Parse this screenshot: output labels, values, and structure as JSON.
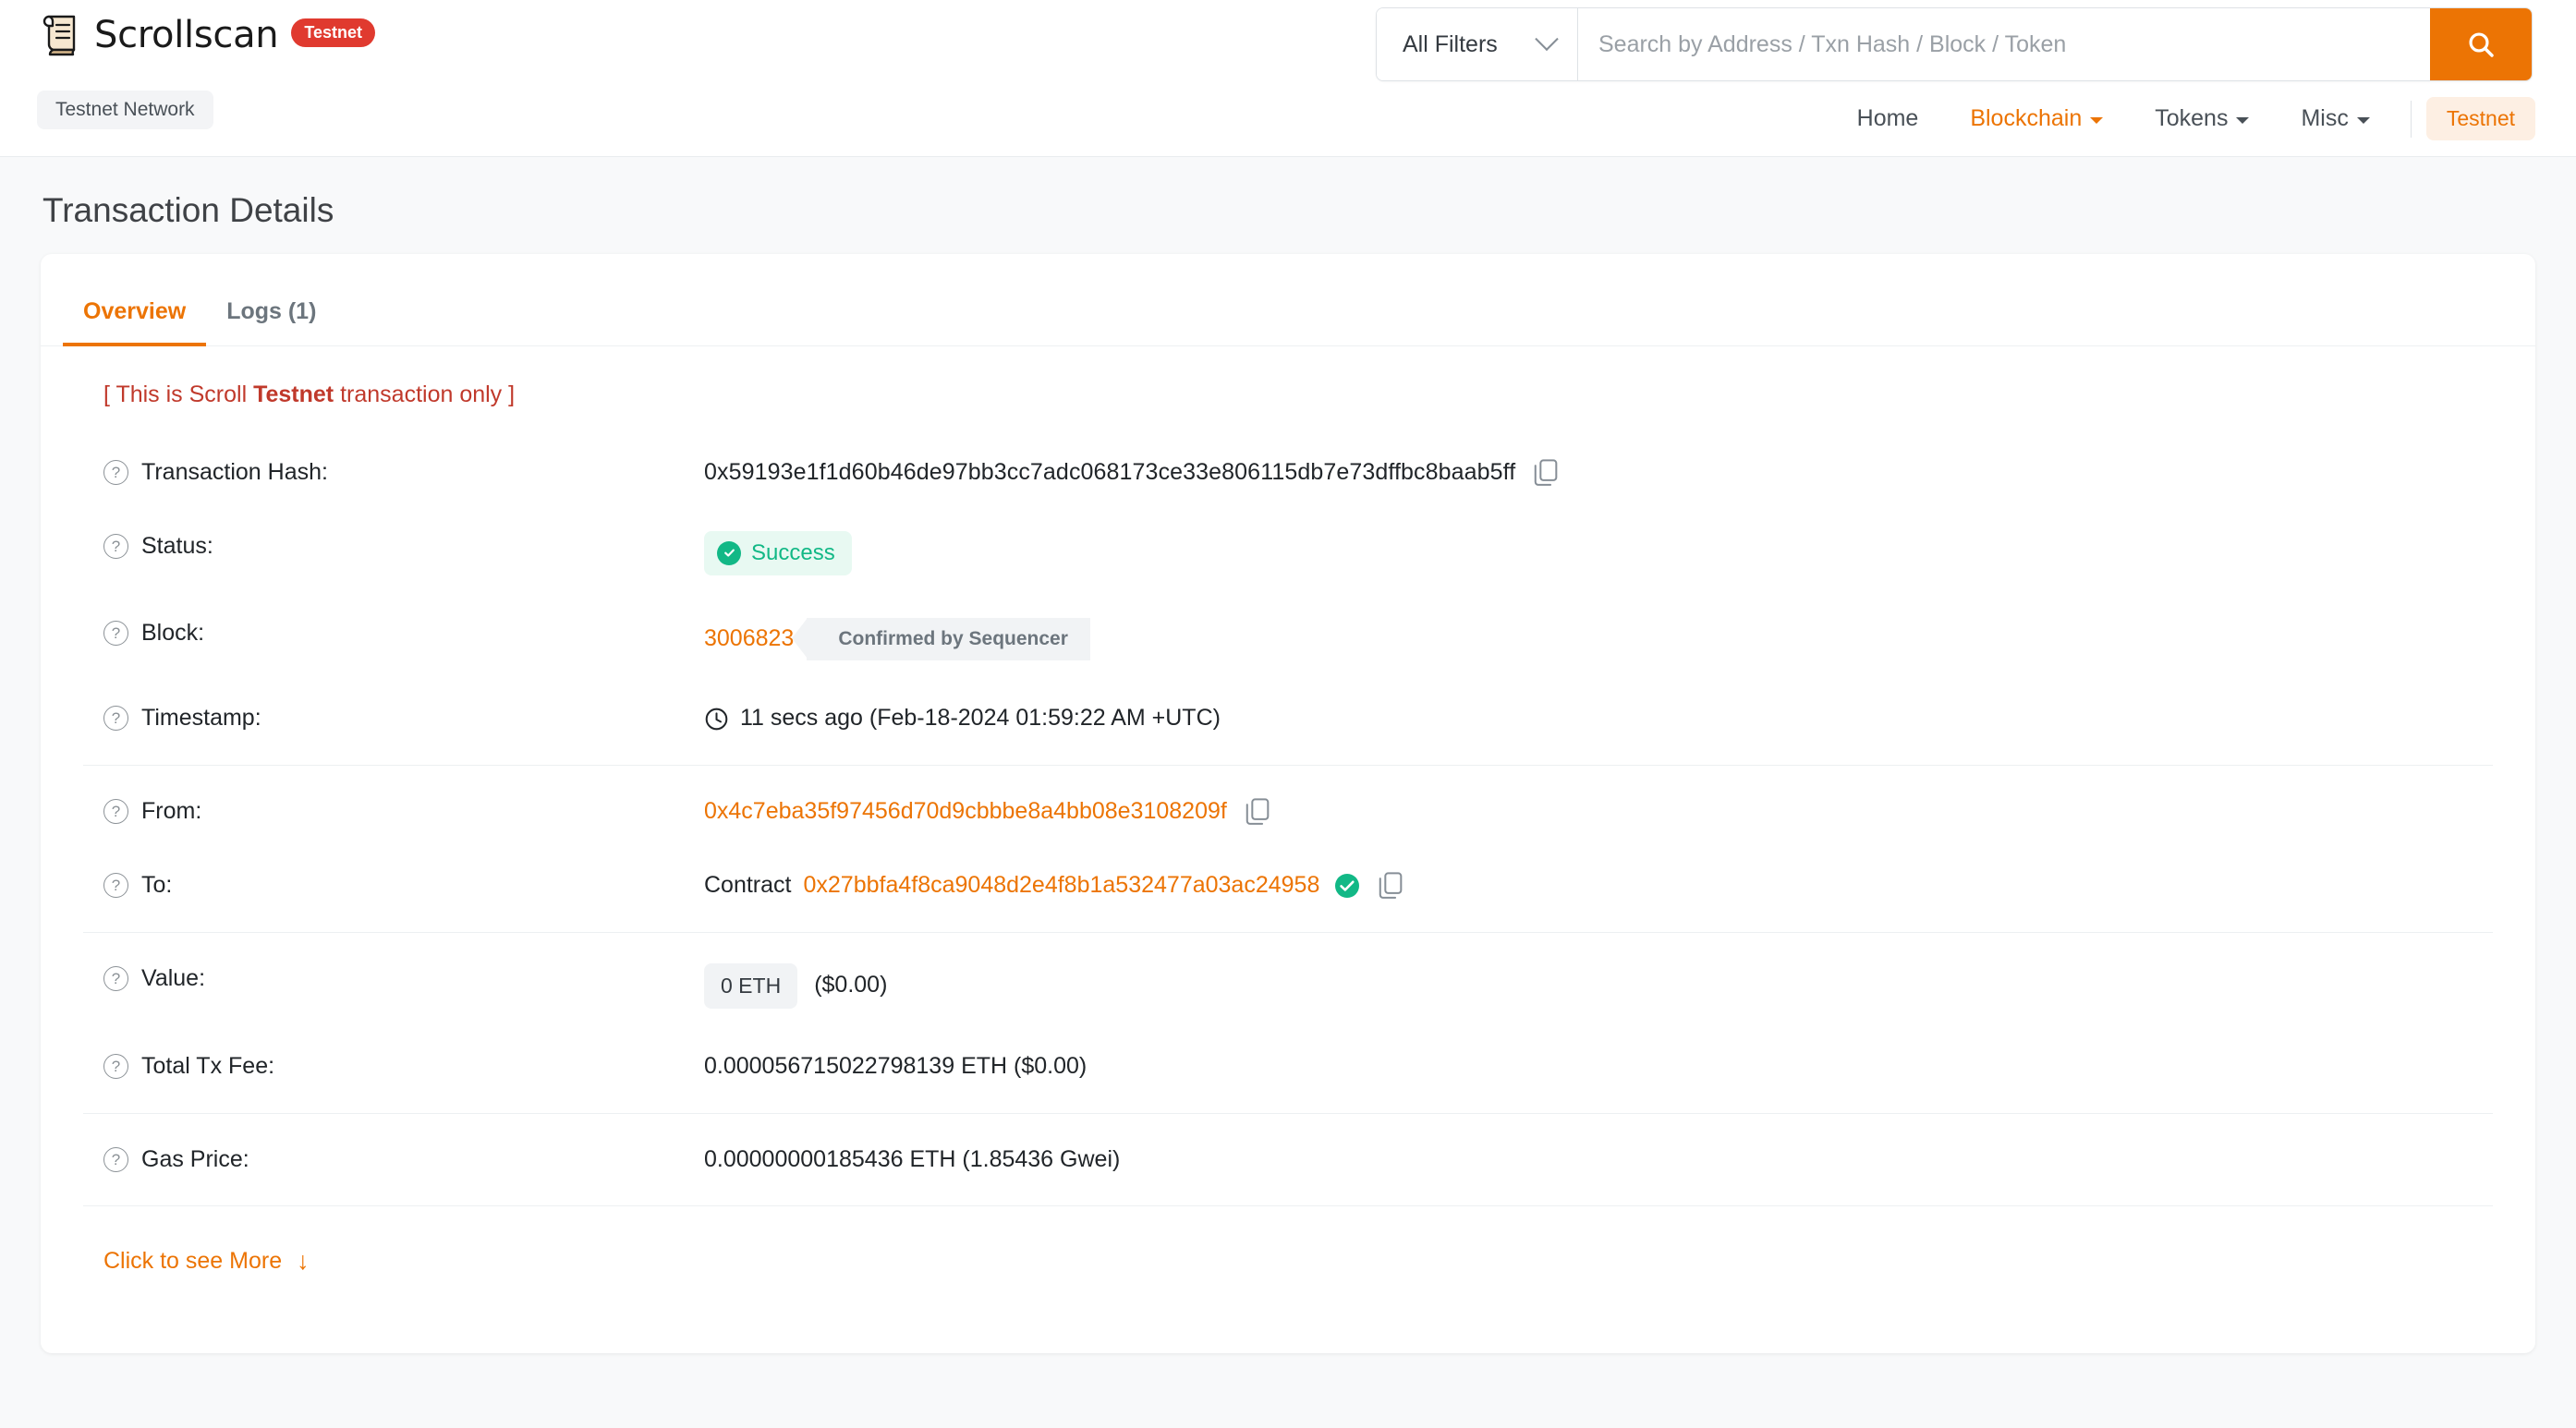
{
  "header": {
    "brand": "Scrollscan",
    "brand_badge": "Testnet",
    "network_chip": "Testnet Network",
    "search": {
      "filter_label": "All Filters",
      "placeholder": "Search by Address / Txn Hash / Block / Token",
      "value": ""
    },
    "nav": [
      {
        "label": "Home",
        "active": false,
        "has_caret": false
      },
      {
        "label": "Blockchain",
        "active": true,
        "has_caret": true
      },
      {
        "label": "Tokens",
        "active": false,
        "has_caret": true
      },
      {
        "label": "Misc",
        "active": false,
        "has_caret": true
      }
    ],
    "network_badge": "Testnet"
  },
  "page": {
    "title": "Transaction Details"
  },
  "tabs": [
    {
      "label": "Overview",
      "active": true
    },
    {
      "label": "Logs (1)",
      "active": false
    }
  ],
  "notice": {
    "prefix": "[ This is Scroll ",
    "emphasis": "Testnet",
    "suffix": " transaction only ]"
  },
  "fields": {
    "txn_hash_label": "Transaction Hash:",
    "txn_hash_value": "0x59193e1f1d60b46de97bb3cc7adc068173ce33e806115db7e73dffbc8baab5ff",
    "status_label": "Status:",
    "status_value": "Success",
    "block_label": "Block:",
    "block_value": "3006823",
    "block_confirmation": "Confirmed by Sequencer",
    "timestamp_label": "Timestamp:",
    "timestamp_value": "11 secs ago (Feb-18-2024 01:59:22 AM +UTC)",
    "from_label": "From:",
    "from_value": "0x4c7eba35f97456d70d9cbbbe8a4bb08e3108209f",
    "to_label": "To:",
    "to_prefix": "Contract",
    "to_value": "0x27bbfa4f8ca9048d2e4f8b1a532477a03ac24958",
    "value_label": "Value:",
    "value_amount": "0 ETH",
    "value_fiat": "($0.00)",
    "fee_label": "Total Tx Fee:",
    "fee_value": "0.000056715022798139 ETH ($0.00)",
    "gas_price_label": "Gas Price:",
    "gas_price_value": "0.00000000185436 ETH (1.85436 Gwei)"
  },
  "see_more": {
    "label": "Click to see More",
    "icon": "arrow-down-icon"
  },
  "colors": {
    "accent": "#ec7404",
    "success": "#12b886",
    "danger": "#c0392b",
    "badge_red": "#e03a2f"
  }
}
